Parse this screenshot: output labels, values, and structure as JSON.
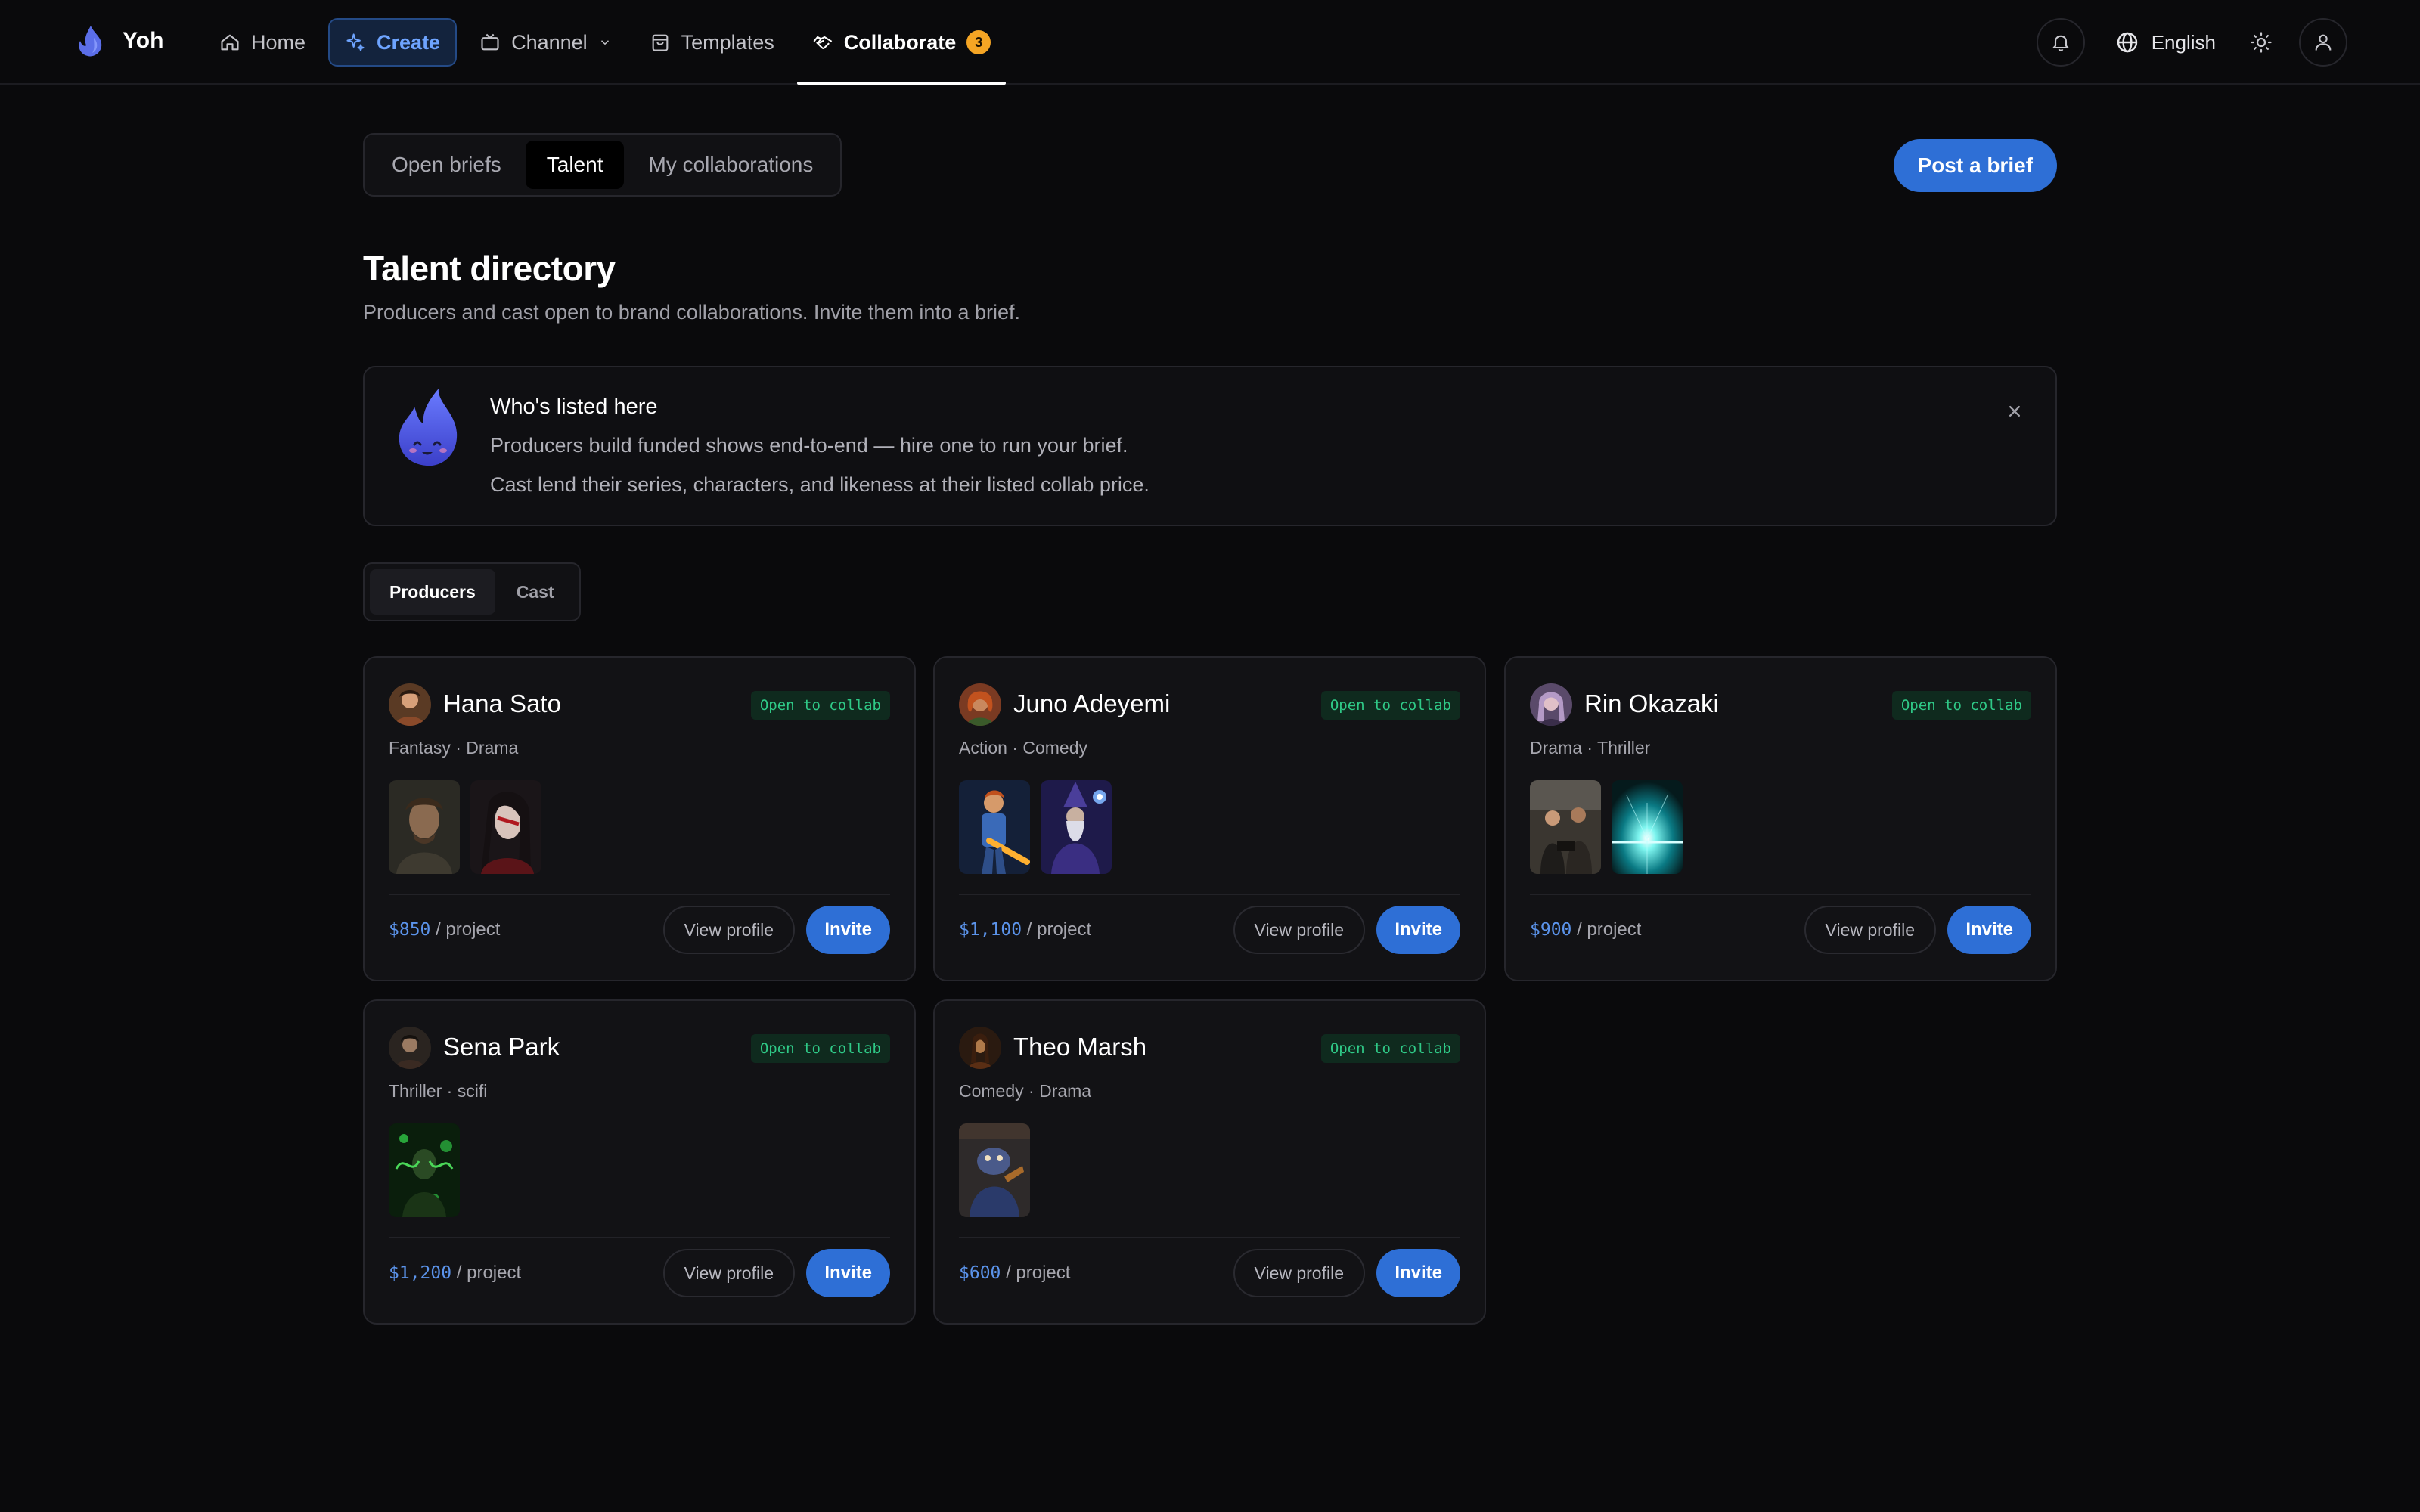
{
  "app": {
    "name": "Yoh"
  },
  "nav": {
    "home": "Home",
    "create": "Create",
    "channel": "Channel",
    "templates": "Templates",
    "collaborate": "Collaborate",
    "collaborate_badge": "3"
  },
  "header_tools": {
    "language": "English"
  },
  "tabs": [
    {
      "label": "Open briefs",
      "active": false
    },
    {
      "label": "Talent",
      "active": true
    },
    {
      "label": "My collaborations",
      "active": false
    }
  ],
  "post_brief_label": "Post a brief",
  "page": {
    "title": "Talent directory",
    "subtitle": "Producers and cast open to brand collaborations. Invite them into a brief."
  },
  "info": {
    "title": "Who's listed here",
    "line1": "Producers build funded shows end-to-end — hire one to run your brief.",
    "line2": "Cast lend their series, characters, and likeness at their listed collab price."
  },
  "subtabs": [
    {
      "label": "Producers",
      "active": true
    },
    {
      "label": "Cast",
      "active": false
    }
  ],
  "cards": [
    {
      "name": "Hana Sato",
      "status": "Open to collab",
      "genres": "Fantasy · Drama",
      "price": "$850",
      "unit": "/ project",
      "view_label": "View profile",
      "invite_label": "Invite",
      "thumbs": 2
    },
    {
      "name": "Juno Adeyemi",
      "status": "Open to collab",
      "genres": "Action · Comedy",
      "price": "$1,100",
      "unit": "/ project",
      "view_label": "View profile",
      "invite_label": "Invite",
      "thumbs": 2
    },
    {
      "name": "Rin Okazaki",
      "status": "Open to collab",
      "genres": "Drama · Thriller",
      "price": "$900",
      "unit": "/ project",
      "view_label": "View profile",
      "invite_label": "Invite",
      "thumbs": 2
    },
    {
      "name": "Sena Park",
      "status": "Open to collab",
      "genres": "Thriller · scifi",
      "price": "$1,200",
      "unit": "/ project",
      "view_label": "View profile",
      "invite_label": "Invite",
      "thumbs": 1
    },
    {
      "name": "Theo Marsh",
      "status": "Open to collab",
      "genres": "Comedy · Drama",
      "price": "$600",
      "unit": "/ project",
      "view_label": "View profile",
      "invite_label": "Invite",
      "thumbs": 1
    }
  ],
  "colors": {
    "accent": "#2e6fd6",
    "background": "#0a0a0c",
    "status_green": "#2fc987",
    "badge_orange": "#f5a524"
  }
}
